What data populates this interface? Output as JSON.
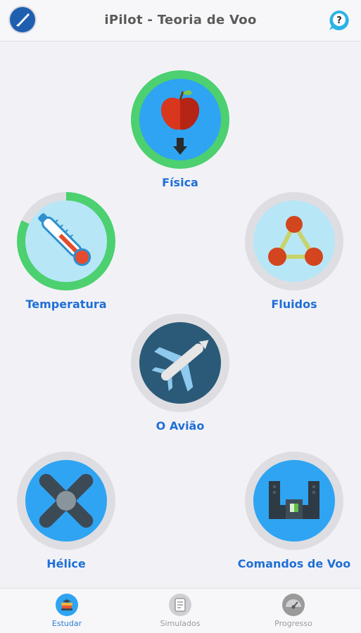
{
  "header": {
    "title": "iPilot - Teoria de Voo"
  },
  "topics": {
    "fisica": {
      "label": "Física",
      "progress": 1.0
    },
    "temperatura": {
      "label": "Temperatura",
      "progress": 0.82
    },
    "fluidos": {
      "label": "Fluidos",
      "progress": 0
    },
    "aviao": {
      "label": "O Avião",
      "progress": 0
    },
    "helice": {
      "label": "Hélice",
      "progress": 0
    },
    "comandos": {
      "label": "Comandos de Voo",
      "progress": 0
    }
  },
  "tabs": [
    {
      "label": "Estudar",
      "active": true
    },
    {
      "label": "Simulados",
      "active": false
    },
    {
      "label": "Progresso",
      "active": false
    }
  ],
  "colors": {
    "accent": "#1f6fd6",
    "progress": "#4cd070",
    "track": "#dedee2"
  }
}
